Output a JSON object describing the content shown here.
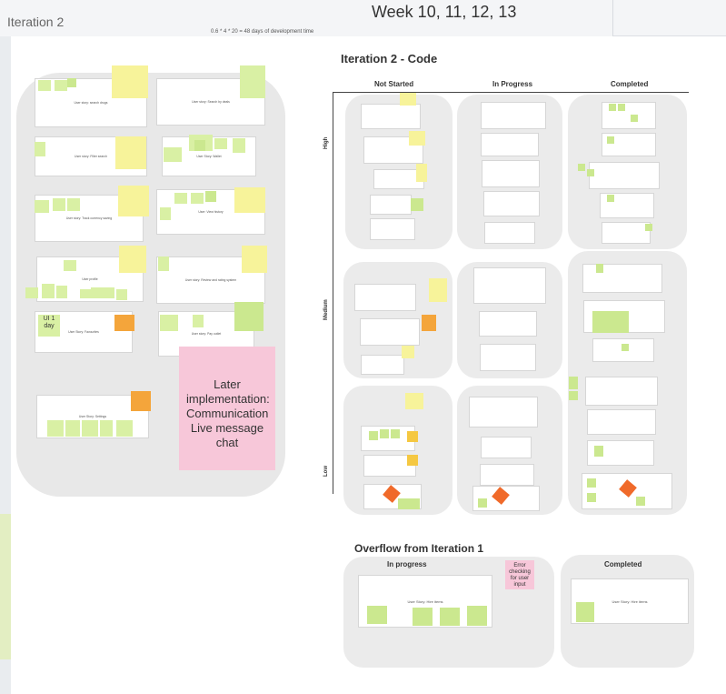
{
  "header": {
    "iteration_label": "Iteration 2",
    "weeks": "Week 10, 11, 12, 13",
    "dev_time_note": "0.6 * 4 * 20 = 48 days of development time"
  },
  "board": {
    "title": "Iteration 2 - Code",
    "columns": [
      "Not Started",
      "In Progress",
      "Completed"
    ],
    "priorities": [
      "High",
      "Medium",
      "Low"
    ]
  },
  "backlog": {
    "later_note": "Later implementation: Communication Live message chat",
    "stories": [
      "User story: search drugs",
      "User story: Search by deals",
      "User story: Filter search",
      "User Story: Wallet",
      "User story: Track currency saving",
      "User: View history",
      "User profile",
      "User story: Review and rating system",
      "User Story: Favourites",
      "User story: Pay outlet",
      "User Story: Settings"
    ],
    "ui_labels": [
      "UI 1 day",
      "UI 1/2 Day",
      "UI 1/2 Day"
    ]
  },
  "overflow": {
    "title": "Overflow from Iteration 1",
    "in_progress": "In progress",
    "completed": "Completed",
    "error_note": "Error checking for user input",
    "story_in_progress": "User Story: Hire items",
    "story_completed": "User Story: Hire items"
  }
}
